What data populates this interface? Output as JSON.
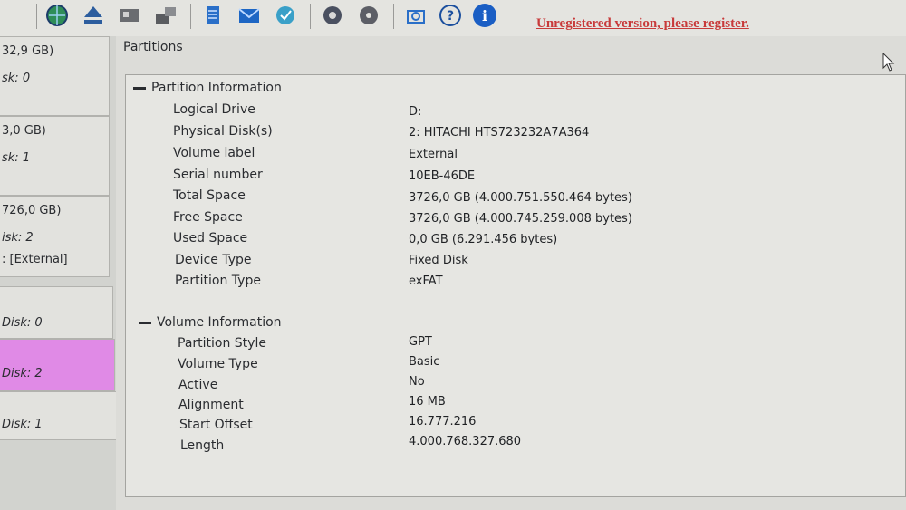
{
  "toolbar": {
    "unregistered_text": "Unregistered version, please register.",
    "icons": [
      "globe-icon",
      "eject-icon",
      "gears-icon",
      "disk-move-icon",
      "notepad-icon",
      "mail-icon",
      "update-icon",
      "settings-icon",
      "disc-icon",
      "camera-icon",
      "help-icon",
      "info-icon"
    ]
  },
  "disks": [
    {
      "line1": "32,9 GB)",
      "line2": "sk: 0"
    },
    {
      "line1": "3,0 GB)",
      "line2": "sk: 1"
    },
    {
      "line1": "726,0 GB)",
      "line2": "isk: 2",
      "line3": ": [External]"
    },
    {
      "line1": "Disk: 0"
    },
    {
      "line1": "Disk: 2",
      "selected": true
    },
    {
      "line1": "Disk: 1"
    }
  ],
  "main": {
    "title": "Partitions",
    "partition_section": "Partition Information",
    "volume_section": "Volume Information",
    "partition_rows": [
      {
        "label": "Logical Drive",
        "value": "D:"
      },
      {
        "label": "Physical Disk(s)",
        "value": "2: HITACHI HTS723232A7A364"
      },
      {
        "label": "Volume label",
        "value": "External"
      },
      {
        "label": "Serial number",
        "value": "10EB-46DE"
      },
      {
        "label": "Total Space",
        "value": "3726,0 GB (4.000.751.550.464 bytes)"
      },
      {
        "label": "Free Space",
        "value": "3726,0 GB (4.000.745.259.008 bytes)"
      },
      {
        "label": "Used Space",
        "value": "0,0 GB (6.291.456 bytes)"
      },
      {
        "label": "Device Type",
        "value": "Fixed Disk"
      },
      {
        "label": "Partition Type",
        "value": "exFAT"
      }
    ],
    "volume_rows": [
      {
        "label": "Partition Style",
        "value": "GPT"
      },
      {
        "label": "Volume Type",
        "value": "Basic"
      },
      {
        "label": "Active",
        "value": "No"
      },
      {
        "label": "Alignment",
        "value": "16 MB"
      },
      {
        "label": "Start Offset",
        "value": "16.777.216"
      },
      {
        "label": "Length",
        "value": "4.000.768.327.680"
      }
    ]
  },
  "colors": {
    "selected_disk": "#e08ae6",
    "unregistered": "#c83a3a"
  }
}
